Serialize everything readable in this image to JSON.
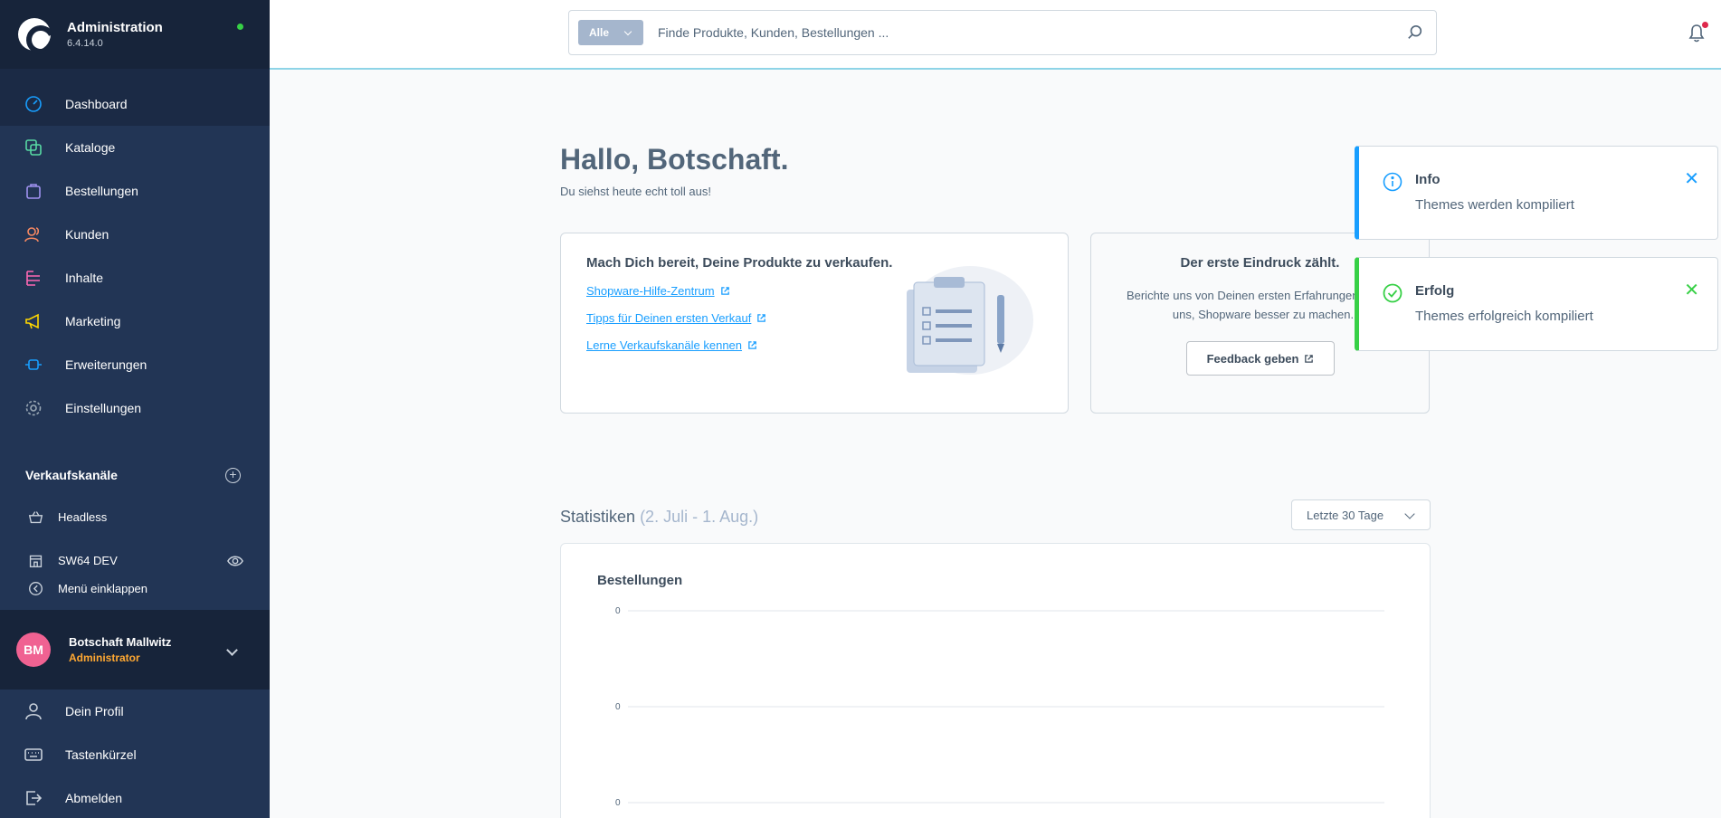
{
  "app": {
    "title": "Administration",
    "version": "6.4.14.0"
  },
  "nav": {
    "items": [
      {
        "label": "Dashboard",
        "icon": "dashboard-icon",
        "color": "#189eff"
      },
      {
        "label": "Kataloge",
        "icon": "catalog-icon",
        "color": "#57d9a3"
      },
      {
        "label": "Bestellungen",
        "icon": "shopping-bag-icon",
        "color": "#a092f0"
      },
      {
        "label": "Kunden",
        "icon": "customers-icon",
        "color": "#f88962"
      },
      {
        "label": "Inhalte",
        "icon": "content-icon",
        "color": "#ff68b4"
      },
      {
        "label": "Marketing",
        "icon": "megaphone-icon",
        "color": "#ffd700"
      },
      {
        "label": "Erweiterungen",
        "icon": "plug-icon",
        "color": "#189eff"
      },
      {
        "label": "Einstellungen",
        "icon": "gear-icon",
        "color": "#9aa8b5"
      }
    ]
  },
  "sales_channels": {
    "header": "Verkaufskanäle",
    "items": [
      {
        "label": "Headless",
        "icon": "basket-icon"
      },
      {
        "label": "SW64 DEV",
        "icon": "storefront-icon"
      }
    ],
    "collapse_label": "Menü einklappen"
  },
  "user": {
    "initials": "BM",
    "name": "Botschaft Mallwitz",
    "role": "Administrator"
  },
  "user_menu": {
    "items": [
      {
        "label": "Dein Profil",
        "icon": "user-icon"
      },
      {
        "label": "Tastenkürzel",
        "icon": "keyboard-icon"
      },
      {
        "label": "Abmelden",
        "icon": "logout-icon"
      }
    ]
  },
  "search": {
    "type_label": "Alle",
    "placeholder": "Finde Produkte, Kunden, Bestellungen ..."
  },
  "dashboard": {
    "greeting": "Hallo, Botschaft.",
    "subgreeting": "Du siehst heute echt toll aus!",
    "getting_started": {
      "title": "Mach Dich bereit, Deine Produkte zu verkaufen.",
      "links": [
        "Shopware-Hilfe-Zentrum",
        "Tipps für Deinen ersten Verkauf",
        "Lerne Verkaufskanäle kennen"
      ]
    },
    "feedback": {
      "title": "Der erste Eindruck zählt.",
      "description": "Berichte uns von Deinen ersten Erfahrungen und hilf uns, Shopware besser zu machen.",
      "button": "Feedback geben"
    },
    "statistics": {
      "title": "Statistiken",
      "range": "(2. Juli - 1. Aug.)",
      "range_select": "Letzte 30 Tage",
      "chart_title": "Bestellungen"
    }
  },
  "chart_data": {
    "type": "line",
    "title": "Bestellungen",
    "y_ticks": [
      "0",
      "0",
      "0"
    ],
    "series": [],
    "grid": true
  },
  "toasts": [
    {
      "type": "info",
      "title": "Info",
      "message": "Themes werden kompiliert",
      "color": "#189eff"
    },
    {
      "type": "success",
      "title": "Erfolg",
      "message": "Themes erfolgreich kompiliert",
      "color": "#37d046"
    }
  ]
}
